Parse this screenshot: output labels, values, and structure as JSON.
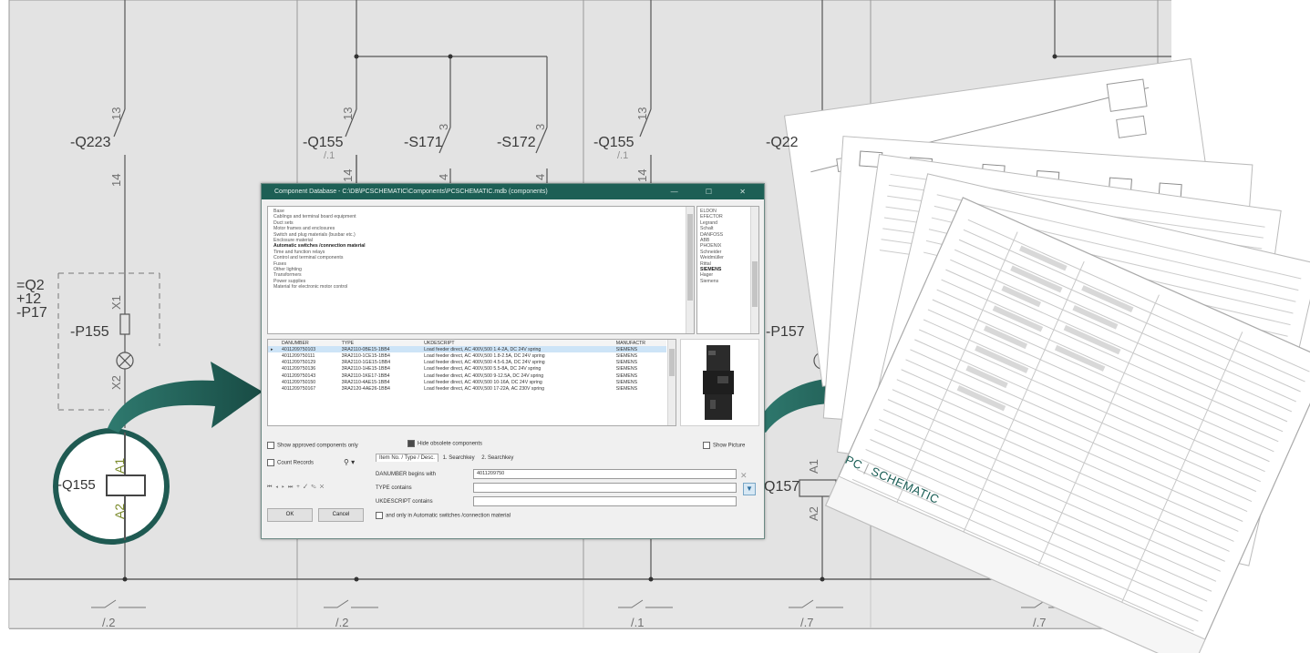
{
  "schematic": {
    "left_symbol": {
      "breaker_label": "-Q223",
      "contact_top": "13",
      "contact_bottom": "14"
    },
    "mid_symbols": [
      {
        "label": "-Q155",
        "ref": "/.1",
        "top": "13",
        "bottom": "14"
      },
      {
        "label": "-S171",
        "top": "3",
        "bottom": "4"
      },
      {
        "label": "-S172",
        "top": "3",
        "bottom": "4"
      },
      {
        "label": "-Q155",
        "ref": "/.1",
        "top": "13",
        "bottom": "14"
      },
      {
        "label": "-Q22",
        "top": "",
        "bottom": ""
      }
    ],
    "location": {
      "line1": "=Q2",
      "line2": "+12",
      "line3": "-P17"
    },
    "lamp_left": {
      "label": "-P155",
      "x1": "X1",
      "x2": "X2"
    },
    "lamp_right": {
      "label": "-P157"
    },
    "coil_zoom": {
      "label": "-Q155",
      "a1": "A1",
      "a2": "A2"
    },
    "coil_right": {
      "label": "Q157",
      "a1": "A1",
      "a2": "A2"
    },
    "bottom_refs": [
      "/.2",
      "/.2",
      "/.1",
      "/.7",
      "/.7"
    ]
  },
  "dialog": {
    "title": "Component Database - C:\\DB\\PCSCHEMATIC\\Components\\PCSCHEMATIC.mdb (components)",
    "window_controls": "—  ☐  ✕",
    "tree_items": [
      "Base",
      "Cablings and terminal board equipment",
      "Duct sets",
      "Motor frames and enclosures",
      "Switch and plug materials (busbar etc.)",
      "Enclosure material",
      "Automatic switches /connection material",
      "Time and function relays",
      "Control and terminal components",
      "Fuses",
      "Other lighting",
      "Transformers",
      "Power supplies",
      "Material for electronic motor control"
    ],
    "tree_selected": "Automatic switches /connection material",
    "manufacturers": [
      "ELDON",
      "EFECTOR",
      "Legrand",
      "Schalt",
      "DANFOSS",
      "ABB",
      "PHOENIX",
      "Schneider",
      "Weidmüller",
      "Rittal",
      "SIEMENS",
      "Hager",
      "Siemens"
    ],
    "manufacturer_selected": "SIEMENS",
    "table": {
      "columns": [
        "DANUMBER",
        "TYPE",
        "UKDESCRIPT",
        "MANUFACTR"
      ],
      "rows": [
        [
          "4011209750103",
          "3RA2110-0BE15-1BB4",
          "Load feeder direct, AC 400V,500 1.4-2A, DC 24V spring",
          "SIEMENS"
        ],
        [
          "4011209750111",
          "3RA2110-1CE15-1BB4",
          "Load feeder direct, AC 400V,500 1.8-2.5A, DC 24V spring",
          "SIEMENS"
        ],
        [
          "4011209750129",
          "3RA2110-1GE15-1BB4",
          "Load feeder direct, AC 400V,500 4.5-6.3A, DC 24V spring",
          "SIEMENS"
        ],
        [
          "4011209750136",
          "3RA2110-1HE15-1BB4",
          "Load feeder direct, AC 400V,500 5.5-8A, DC 24V spring",
          "SIEMENS"
        ],
        [
          "4011209750143",
          "3RA2110-1KE17-1BB4",
          "Load feeder direct, AC 400V,500 9-12.5A, DC 24V spring",
          "SIEMENS"
        ],
        [
          "4011209750150",
          "3RA2110-4AE15-1BB4",
          "Load feeder direct, AC 400V,500 10-16A, DC 24V spring",
          "SIEMENS"
        ],
        [
          "4011209750167",
          "3RA2120-4AE26-1BB4",
          "Load feeder direct, AC 400V,500 17-22A, AC 230V spring",
          "SIEMENS"
        ]
      ],
      "selected_index": 0
    },
    "show_approved": "Show approved components only",
    "hide_obsolete": "Hide obsolete components",
    "show_picture": "Show Picture",
    "count_records": "Count Records",
    "search_tabs": [
      "Item No. / Type / Desc.",
      "1. Searchkey",
      "2. Searchkey"
    ],
    "fields": [
      {
        "label": "DANUMBER begins with",
        "value": "4011209750"
      },
      {
        "label": "TYPE contains",
        "value": ""
      },
      {
        "label": "UKDESCRIPT contains",
        "value": ""
      }
    ],
    "search_only": "and only in Automatic switches /connection material",
    "ok": "OK",
    "cancel": "Cancel",
    "nav_glyphs": [
      "⏮",
      "◂",
      "▸",
      "⏭",
      "+",
      "✓",
      "✎",
      "✕"
    ]
  },
  "brand": {
    "part1": "PC",
    "part2": "SCHEMATIC"
  },
  "colors": {
    "arrow": "#1f5a52",
    "grid_bg": "#e2e2e2",
    "accent": "#1d5f55"
  }
}
